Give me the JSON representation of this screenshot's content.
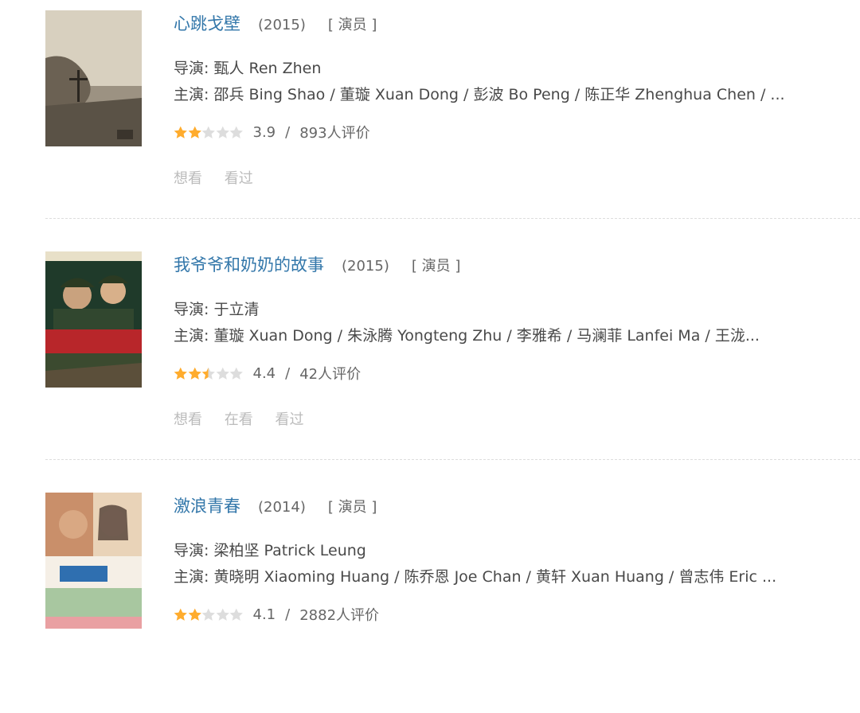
{
  "items": [
    {
      "title": "心跳戈壁",
      "year": "(2015)",
      "role": "[ 演员 ]",
      "director": "导演: 甄人 Ren Zhen",
      "cast": "主演: 邵兵 Bing Shao / 董璇 Xuan Dong / 彭波 Bo Peng / 陈正华 Zhenghua Chen / ...",
      "rating": {
        "stars": 2,
        "score": "3.9",
        "sep": "/",
        "count": "893人评价"
      },
      "actions": [
        "想看",
        "看过"
      ],
      "poster_title": "心跳戈壁",
      "poster_colors": {
        "sky": "#d8d0bf",
        "ground": "#6b6153",
        "mid": "#9c9282"
      }
    },
    {
      "title": "我爷爷和奶奶的故事",
      "year": "(2015)",
      "role": "[ 演员 ]",
      "director": "导演: 于立清",
      "cast": "主演: 董璇 Xuan Dong / 朱泳腾 Yongteng Zhu / 李雅希 / 马澜菲 Lanfei Ma / 王泷...",
      "rating": {
        "stars": 2.5,
        "score": "4.4",
        "sep": "/",
        "count": "42人评价"
      },
      "actions": [
        "想看",
        "在看",
        "看过"
      ],
      "poster_title": "我爷爷和奶奶的故事",
      "poster_colors": {
        "sky": "#1f3a2a",
        "ground": "#3b4a2f",
        "mid": "#b8262a"
      }
    },
    {
      "title": "激浪青春",
      "year": "(2014)",
      "role": "[ 演员 ]",
      "director": "导演: 梁柏坚 Patrick Leung",
      "cast": "主演: 黄晓明 Xiaoming Huang / 陈乔恩 Joe Chan / 黄轩 Xuan Huang / 曾志伟 Eric ...",
      "rating": {
        "stars": 2,
        "score": "4.1",
        "sep": "/",
        "count": "2882人评价"
      },
      "actions": [],
      "poster_title": "激浪青春",
      "poster_colors": {
        "sky": "#f2e6d2",
        "ground": "#e9a0a2",
        "mid": "#2f6fb0"
      }
    }
  ],
  "colors": {
    "link": "#3377aa",
    "star_on": "#ffac2d",
    "star_off": "#dddddd"
  }
}
